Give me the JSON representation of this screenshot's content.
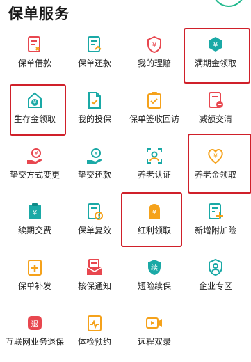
{
  "title": "保单服务",
  "colors": {
    "red": "#e8474f",
    "teal": "#1aa9a6",
    "orange": "#f5a21b",
    "highlight": "#d0202a"
  },
  "services": [
    {
      "label": "保单借款",
      "icon": "policy-loan-icon"
    },
    {
      "label": "保单还款",
      "icon": "policy-repay-icon"
    },
    {
      "label": "我的理赔",
      "icon": "my-claims-icon"
    },
    {
      "label": "满期金领取",
      "icon": "maturity-benefit-icon"
    },
    {
      "label": "生存金领取",
      "icon": "survival-benefit-icon"
    },
    {
      "label": "我的投保",
      "icon": "my-application-icon"
    },
    {
      "label": "保单签收回访",
      "icon": "policy-receipt-icon"
    },
    {
      "label": "减额交清",
      "icon": "reduced-paidup-icon"
    },
    {
      "label": "垫交方式变更",
      "icon": "premium-loan-change-icon"
    },
    {
      "label": "垫交还款",
      "icon": "premium-loan-repay-icon"
    },
    {
      "label": "养老认证",
      "icon": "pension-auth-icon"
    },
    {
      "label": "养老金领取",
      "icon": "pension-benefit-icon"
    },
    {
      "label": "续期交费",
      "icon": "renewal-payment-icon"
    },
    {
      "label": "保单复效",
      "icon": "policy-reinstate-icon"
    },
    {
      "label": "红利领取",
      "icon": "dividend-icon"
    },
    {
      "label": "新增附加险",
      "icon": "add-rider-icon"
    },
    {
      "label": "保单补发",
      "icon": "policy-reissue-icon"
    },
    {
      "label": "核保通知",
      "icon": "underwriting-notice-icon"
    },
    {
      "label": "短险续保",
      "icon": "short-term-renewal-icon"
    },
    {
      "label": "企业专区",
      "icon": "enterprise-zone-icon"
    },
    {
      "label": "互联网业务退保",
      "icon": "internet-surrender-icon"
    },
    {
      "label": "体检预约",
      "icon": "medical-exam-icon"
    },
    {
      "label": "远程双录",
      "icon": "remote-recording-icon"
    }
  ]
}
